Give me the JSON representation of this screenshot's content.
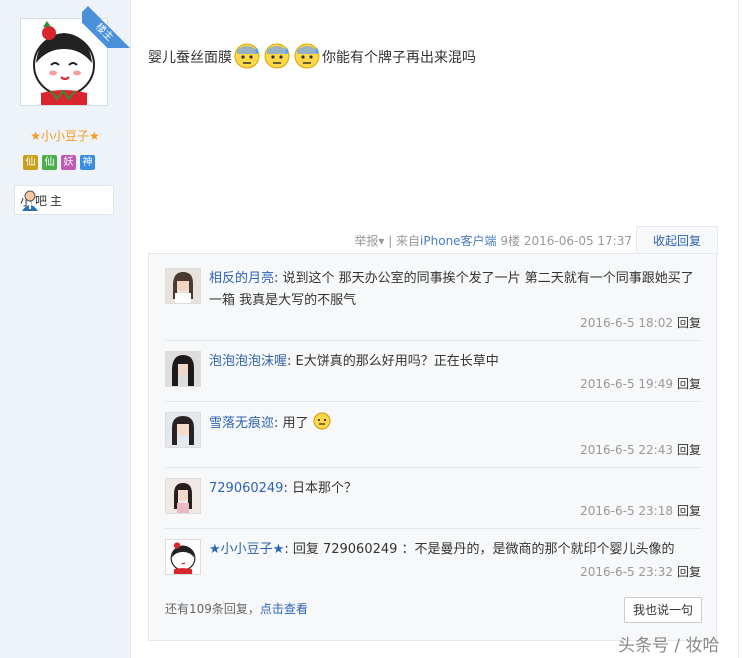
{
  "sidebar": {
    "ribbon": "楼主",
    "username": "★小小豆子★",
    "badges": [
      {
        "char": "仙",
        "color": "#c8a11c"
      },
      {
        "char": "仙",
        "color": "#4cae4c"
      },
      {
        "char": "妖",
        "color": "#c05ab5"
      },
      {
        "char": "神",
        "color": "#3d8de0"
      }
    ],
    "role": "小吧主"
  },
  "post": {
    "text_before": "婴儿蚕丝面膜",
    "text_after": "你能有个牌子再出来混吗",
    "emoji_count": 3
  },
  "meta": {
    "report": "举报",
    "source_prefix": "| 来自",
    "source": "iPhone客户端",
    "floor": "9楼",
    "datetime": "2016-06-05 17:37",
    "collapse": "收起回复"
  },
  "replies": [
    {
      "name": "相反的月亮",
      "text": "说到这个 那天办公室的同事挨个发了一片 第二天就有一个同事跟她买了一箱 我真是大写的不服气",
      "time": "2016-6-5 18:02",
      "reply": "回复"
    },
    {
      "name": "泡泡泡泡沫喔",
      "text": "E大饼真的那么好用吗？正在长草中",
      "time": "2016-6-5 19:49",
      "reply": "回复"
    },
    {
      "name": "雪落无痕迩",
      "text": "用了",
      "time": "2016-6-5 22:43",
      "reply": "回复"
    },
    {
      "name": "729060249",
      "text": "日本那个？",
      "time": "2016-6-5 23:18",
      "reply": "回复"
    },
    {
      "name": "★小小豆子★",
      "text": "回复 729060249 ：不是曼丹的，是微商的那个就印个婴儿头像的",
      "time": "2016-6-5 23:32",
      "reply": "回复"
    }
  ],
  "footer": {
    "more_prefix": "还有109条回复，",
    "more_link": "点击查看",
    "say_button": "我也说一句"
  },
  "watermark": "头条号 / 妆哈"
}
